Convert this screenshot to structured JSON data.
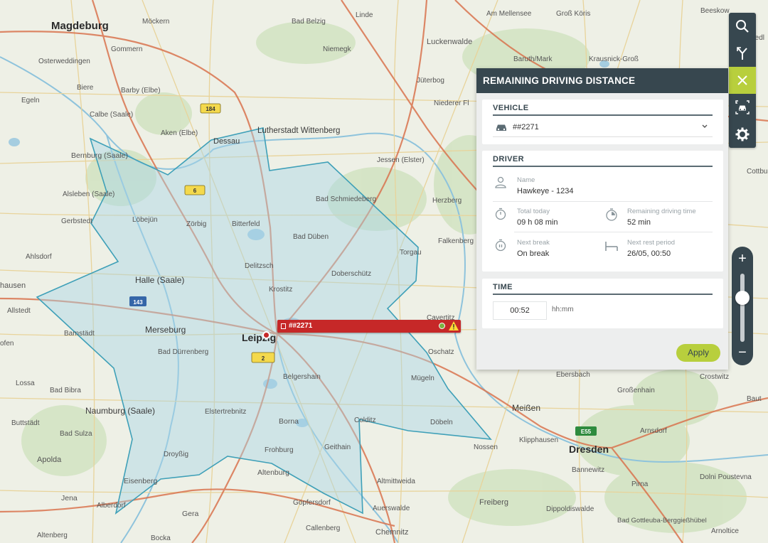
{
  "map": {
    "cities": {
      "magdeburg": "Magdeburg",
      "leipzig": "Leipzig",
      "dresden": "Dresden",
      "halle": "Halle (Saale)",
      "lutherstadt": "Lutherstadt Wittenberg",
      "dessau": "Dessau",
      "merseburg": "Merseburg",
      "naumburg": "Naumburg (Saale)",
      "meissen": "Meißen"
    },
    "towns": {
      "mockern": "Möckern",
      "badbelzig": "Bad Belzig",
      "niemegk": "Niemegk",
      "luckenwalde": "Luckenwalde",
      "ammellensee": "Am Mellensee",
      "grosskoris": "Groß Köris",
      "beeskow": "Beeskow",
      "baruth": "Baruth/Mark",
      "krausnick": "Krausnick-Groß",
      "juterbog": "Jüterbog",
      "niederer": "Niederer Fl",
      "gommern": "Gommern",
      "osterweddingen": "Osterweddingen",
      "biere": "Biere",
      "barby": "Barby (Elbe)",
      "egeln": "Egeln",
      "calbe": "Calbe (Saale)",
      "aken": "Aken (Elbe)",
      "bernburg": "Bernburg (Saale)",
      "jessen": "Jessen (Elster)",
      "aisleben": "Alsleben (Saale)",
      "gerbstedt": "Gerbstedt",
      "lobejun": "Löbejün",
      "zorbig": "Zörbig",
      "bitterfeld": "Bitterfeld",
      "badschmiedeberg": "Bad Schmiedeberg",
      "herzberg": "Herzberg",
      "baddueben": "Bad Düben",
      "falkenberg": "Falkenberg",
      "torgau": "Torgau",
      "ahisdorf": "Ahlsdorf",
      "hausen": "hausen",
      "delitzsch": "Delitzsch",
      "doberschutz": "Doberschütz",
      "krostitz": "Krostitz",
      "allstedt": "Allstedt",
      "barnstadt": "Barnstädt",
      "cavertitz": "Cavertitz",
      "baddurrenberg": "Bad Dürrenberg",
      "oschatz": "Oschatz",
      "belgershain": "Belgershain",
      "mugeln": "Mügeln",
      "lossa": "Lossa",
      "badbibra": "Bad Bibra",
      "ebersbach": "Ebersbach",
      "grossenhain": "Großenhain",
      "elstertrebnitz": "Elstertrebnitz",
      "colditz": "Colditz",
      "dobeln": "Döbeln",
      "buttstadt": "Buttstädt",
      "badsulza": "Bad Sulza",
      "borna": "Borna",
      "nossen": "Nossen",
      "klipphausen": "Klipphausen",
      "arnsdorf": "Arnsdorf",
      "apolda": "Apolda",
      "dropzig": "Droyßig",
      "frohburg": "Frohburg",
      "geithain": "Geithain",
      "bannewitz": "Bannewitz",
      "eisenberg": "Eisenberg",
      "altenburg": "Altenburg",
      "altmittweida": "Altmittweida",
      "pirna": "Pirna",
      "dolnipoustevna": "Dolni Poustevna",
      "jena": "Jena",
      "gopfersdorf": "Göpfersdorf",
      "auerswalde": "Auerswalde",
      "freiberg": "Freiberg",
      "dippoldiswalde": "Dippoldiswalde",
      "apolda2": "Alberdorf",
      "gera": "Gera",
      "badgottleuba": "Bad Gottleuba-Berggießhübel",
      "altenberg": "Altenberg",
      "bocka": "Bocka",
      "callenberg": "Callenberg",
      "chemnitz": "Chemnitz",
      "arnoltice": "Arnoltice",
      "lossa2": "ofen",
      "cottbus": "Cottbus",
      "friedland": "Friedl",
      "linde": "Linde",
      "kroswitz": "Crostwitz",
      "bautzen": "Baut"
    },
    "road_shields": [
      "184",
      "6",
      "143",
      "2",
      "E55"
    ]
  },
  "toolbar": {
    "items": [
      {
        "name": "search-tool",
        "icon": "search-icon"
      },
      {
        "name": "route-tool",
        "icon": "route-fork-icon"
      },
      {
        "name": "close-tool",
        "icon": "close-icon",
        "active": true
      },
      {
        "name": "vehicle-tool",
        "icon": "vehicle-icon"
      },
      {
        "name": "settings-tool",
        "icon": "gear-icon"
      }
    ]
  },
  "zoom": {
    "in_label": "+",
    "out_label": "−",
    "level": 0.65
  },
  "panel": {
    "title": "REMAINING DRIVING DISTANCE",
    "vehicle": {
      "title": "VEHICLE",
      "selected": "##2271",
      "icon": "car-icon"
    },
    "driver": {
      "title": "DRIVER",
      "name_label": "Name",
      "name_value": "Hawkeye - 1234",
      "total_today_label": "Total today",
      "total_today_value": "09 h 08 min",
      "remaining_label": "Remaining driving time",
      "remaining_value": "52 min",
      "next_break_label": "Next break",
      "next_break_value": "On break",
      "next_rest_label": "Next rest period",
      "next_rest_value": "26/05, 00:50"
    },
    "time": {
      "title": "TIME",
      "value": "00:52",
      "unit": "hh:mm"
    },
    "apply_label": "Apply"
  },
  "vehicle_marker": {
    "label": "##2271",
    "status_color": "#7cb342"
  },
  "colors": {
    "accent": "#b8cf3d",
    "dark": "#37474f",
    "marker": "#c62828",
    "range_fill": "#a9d4e6",
    "range_stroke": "#3fa0b8"
  }
}
